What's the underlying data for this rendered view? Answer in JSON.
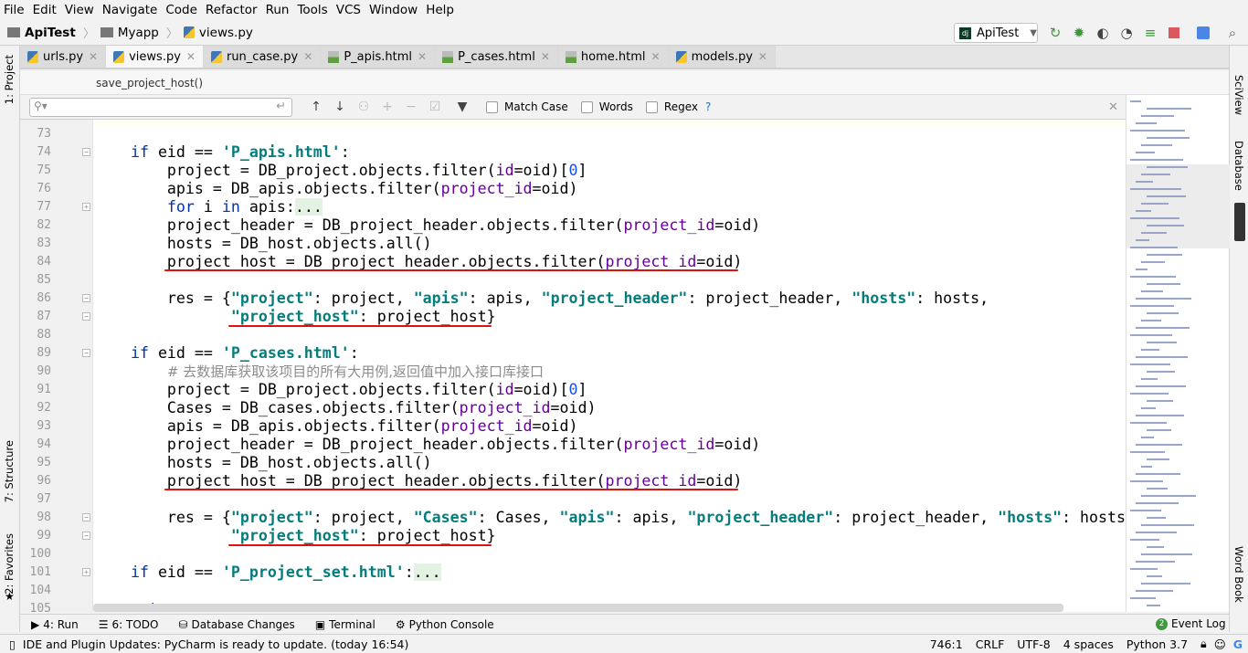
{
  "menu": [
    "File",
    "Edit",
    "View",
    "Navigate",
    "Code",
    "Refactor",
    "Run",
    "Tools",
    "VCS",
    "Window",
    "Help"
  ],
  "breadcrumb": [
    "ApiTest",
    "Myapp",
    "views.py"
  ],
  "run_config": "ApiTest",
  "toolbar_icons": [
    "rerun-icon",
    "debug-icon",
    "coverage-icon",
    "profile-icon",
    "run-concurrency-icon",
    "stop-icon",
    "translate-icon",
    "search-icon"
  ],
  "tabs": [
    {
      "label": "urls.py",
      "type": "py"
    },
    {
      "label": "views.py",
      "type": "py",
      "active": true
    },
    {
      "label": "run_case.py",
      "type": "py"
    },
    {
      "label": "P_apis.html",
      "type": "html"
    },
    {
      "label": "P_cases.html",
      "type": "html"
    },
    {
      "label": "home.html",
      "type": "html"
    },
    {
      "label": "models.py",
      "type": "py"
    }
  ],
  "function_breadcrumb": "save_project_host()",
  "find": {
    "value": "",
    "options": [
      "Match Case",
      "Words",
      "Regex"
    ],
    "help": "?"
  },
  "left_tools": [
    "1: Project",
    "7: Structure",
    "2: Favorites"
  ],
  "right_tools": [
    "SciView",
    "Database",
    "Word Book"
  ],
  "colors": {
    "keyword": "#0033b3",
    "string": "#067d7d",
    "param": "#660099",
    "number": "#1750eb",
    "comment": "#8c8c8c",
    "underline": "#e01010"
  },
  "code": [
    {
      "n": "73",
      "t": []
    },
    {
      "n": "74",
      "fold": "-",
      "t": [
        [
          "p",
          "    "
        ],
        [
          "kw",
          "if"
        ],
        [
          "p",
          " eid == "
        ],
        [
          "str",
          "'P_apis.html'"
        ],
        [
          "p",
          ":"
        ]
      ]
    },
    {
      "n": "75",
      "t": [
        [
          "p",
          "        project = DB_project.objects.filter("
        ],
        [
          "prm",
          "id"
        ],
        [
          "p",
          "=oid)["
        ],
        [
          "num",
          "0"
        ],
        [
          "p",
          "]"
        ]
      ]
    },
    {
      "n": "76",
      "t": [
        [
          "p",
          "        apis = DB_apis.objects.filter("
        ],
        [
          "prm",
          "project_id"
        ],
        [
          "p",
          "=oid)"
        ]
      ]
    },
    {
      "n": "77",
      "fold": "+",
      "t": [
        [
          "p",
          "        "
        ],
        [
          "kw",
          "for"
        ],
        [
          "p",
          " i "
        ],
        [
          "kw",
          "in"
        ],
        [
          "p",
          " apis:"
        ],
        [
          "fl",
          "..."
        ]
      ]
    },
    {
      "n": "82",
      "t": [
        [
          "p",
          "        project_header = DB_project_header.objects.filter("
        ],
        [
          "prm",
          "project_id"
        ],
        [
          "p",
          "=oid)"
        ]
      ]
    },
    {
      "n": "83",
      "t": [
        [
          "p",
          "        hosts = DB_host.objects.all()"
        ]
      ]
    },
    {
      "n": "84",
      "t": [
        [
          "p",
          "        project_host = DB_project_header.objects.filter("
        ],
        [
          "prm",
          "project_id"
        ],
        [
          "p",
          "=oid)"
        ]
      ]
    },
    {
      "n": "85",
      "t": []
    },
    {
      "n": "86",
      "fold": "-",
      "t": [
        [
          "p",
          "        res = {"
        ],
        [
          "str",
          "\"project\""
        ],
        [
          "p",
          ": project, "
        ],
        [
          "str",
          "\"apis\""
        ],
        [
          "p",
          ": apis, "
        ],
        [
          "str",
          "\"project_header\""
        ],
        [
          "p",
          ": project_header, "
        ],
        [
          "str",
          "\"hosts\""
        ],
        [
          "p",
          ": hosts,"
        ]
      ]
    },
    {
      "n": "87",
      "fold": "-",
      "t": [
        [
          "p",
          "               "
        ],
        [
          "str",
          "\"project_host\""
        ],
        [
          "p",
          ": project_host}"
        ]
      ]
    },
    {
      "n": "88",
      "t": []
    },
    {
      "n": "89",
      "fold": "-",
      "t": [
        [
          "p",
          "    "
        ],
        [
          "kw",
          "if"
        ],
        [
          "p",
          " eid == "
        ],
        [
          "str",
          "'P_cases.html'"
        ],
        [
          "p",
          ":"
        ]
      ]
    },
    {
      "n": "90",
      "t": [
        [
          "p",
          "        "
        ],
        [
          "cmt",
          "# 去数据库获取该项目的所有大用例,返回值中加入接口库接口"
        ]
      ]
    },
    {
      "n": "91",
      "t": [
        [
          "p",
          "        project = DB_project.objects.filter("
        ],
        [
          "prm",
          "id"
        ],
        [
          "p",
          "=oid)["
        ],
        [
          "num",
          "0"
        ],
        [
          "p",
          "]"
        ]
      ]
    },
    {
      "n": "92",
      "t": [
        [
          "p",
          "        Cases = DB_cases.objects.filter("
        ],
        [
          "prm",
          "project_id"
        ],
        [
          "p",
          "=oid)"
        ]
      ]
    },
    {
      "n": "93",
      "t": [
        [
          "p",
          "        apis = DB_apis.objects.filter("
        ],
        [
          "prm",
          "project_id"
        ],
        [
          "p",
          "=oid)"
        ]
      ]
    },
    {
      "n": "94",
      "t": [
        [
          "p",
          "        project_header = DB_project_header.objects.filter("
        ],
        [
          "prm",
          "project_id"
        ],
        [
          "p",
          "=oid)"
        ]
      ]
    },
    {
      "n": "95",
      "t": [
        [
          "p",
          "        hosts = DB_host.objects.all()"
        ]
      ]
    },
    {
      "n": "96",
      "t": [
        [
          "p",
          "        project_host = DB_project_header.objects.filter("
        ],
        [
          "prm",
          "project_id"
        ],
        [
          "p",
          "=oid)"
        ]
      ]
    },
    {
      "n": "97",
      "t": []
    },
    {
      "n": "98",
      "fold": "-",
      "t": [
        [
          "p",
          "        res = {"
        ],
        [
          "str",
          "\"project\""
        ],
        [
          "p",
          ": project, "
        ],
        [
          "str",
          "\"Cases\""
        ],
        [
          "p",
          ": Cases, "
        ],
        [
          "str",
          "\"apis\""
        ],
        [
          "p",
          ": apis, "
        ],
        [
          "str",
          "\"project_header\""
        ],
        [
          "p",
          ": project_header, "
        ],
        [
          "str",
          "\"hosts\""
        ],
        [
          "p",
          ": hosts"
        ]
      ]
    },
    {
      "n": "99",
      "fold": "-",
      "t": [
        [
          "p",
          "               "
        ],
        [
          "str",
          "\"project_host\""
        ],
        [
          "p",
          ": project_host}"
        ]
      ]
    },
    {
      "n": "100",
      "t": []
    },
    {
      "n": "101",
      "fold": "+",
      "t": [
        [
          "p",
          "    "
        ],
        [
          "kw",
          "if"
        ],
        [
          "p",
          " eid == "
        ],
        [
          "str",
          "'P_project_set.html'"
        ],
        [
          "p",
          ":"
        ],
        [
          "fl",
          "..."
        ]
      ]
    },
    {
      "n": "104",
      "t": []
    },
    {
      "n": "105",
      "t": [
        [
          "p",
          "    "
        ],
        [
          "kw",
          "return"
        ],
        [
          "p",
          " res"
        ]
      ]
    }
  ],
  "tool_windows": [
    {
      "label": "4: Run",
      "icon": "run-icon"
    },
    {
      "label": "6: TODO",
      "icon": "todo-icon"
    },
    {
      "label": "Database Changes",
      "icon": "database-icon"
    },
    {
      "label": "Terminal",
      "icon": "terminal-icon"
    },
    {
      "label": "Python Console",
      "icon": "python-icon"
    }
  ],
  "event_log": {
    "count": "2",
    "label": "Event Log"
  },
  "status": {
    "message": "IDE and Plugin Updates: PyCharm is ready to update. (today 16:54)",
    "position": "746:1",
    "line_sep": "CRLF",
    "encoding": "UTF-8",
    "indent": "4 spaces",
    "interpreter": "Python 3.7"
  }
}
